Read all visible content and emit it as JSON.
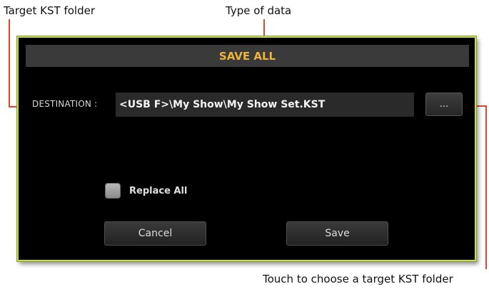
{
  "callouts": {
    "target_folder": "Target KST folder",
    "type_of_data": "Type of data",
    "touch_choose": "Touch to choose a target KST folder"
  },
  "dialog": {
    "title": "SAVE ALL",
    "destination_label": "DESTINATION :",
    "destination_value": "<USB F>\\My Show\\My Show Set.KST",
    "browse_label": "...",
    "replace_all": {
      "label": "Replace All",
      "checked": false
    },
    "cancel_label": "Cancel",
    "save_label": "Save"
  },
  "colors": {
    "leader": "#e0462a",
    "frame": "#c9dd52",
    "title": "#f0b33a"
  }
}
